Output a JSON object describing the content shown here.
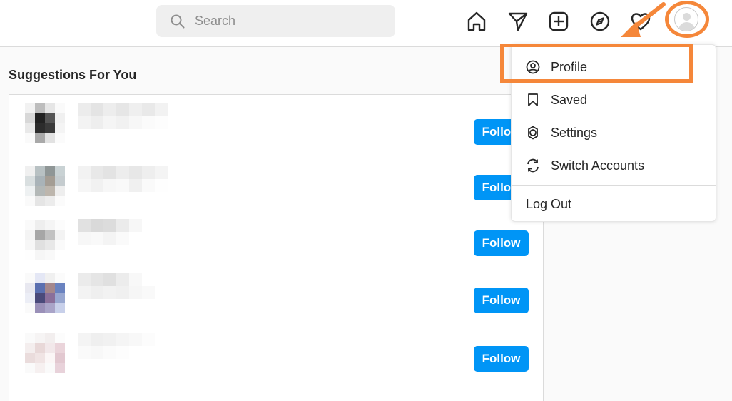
{
  "header": {
    "search": {
      "placeholder": "Search",
      "icon": "search-icon"
    },
    "nav_icons": [
      "home-icon",
      "direct-message-icon",
      "new-post-icon",
      "explore-icon",
      "activity-heart-icon",
      "profile-avatar"
    ]
  },
  "main": {
    "suggestions_title": "Suggestions For You",
    "suggestions": [
      {
        "follow_label": "Follow"
      },
      {
        "follow_label": "Follow"
      },
      {
        "follow_label": "Follow"
      },
      {
        "follow_label": "Follow"
      },
      {
        "follow_label": "Follow"
      }
    ]
  },
  "profile_menu": {
    "items": [
      {
        "label": "Profile",
        "icon": "user-circle-icon"
      },
      {
        "label": "Saved",
        "icon": "bookmark-icon"
      },
      {
        "label": "Settings",
        "icon": "settings-gear-icon"
      },
      {
        "label": "Switch Accounts",
        "icon": "switch-accounts-icon"
      }
    ],
    "logout_label": "Log Out"
  },
  "colors": {
    "accent_annotation": "#f5873a",
    "follow_button": "#0095f6",
    "topbar_bg": "#ffffff",
    "page_bg": "#fafafa"
  }
}
